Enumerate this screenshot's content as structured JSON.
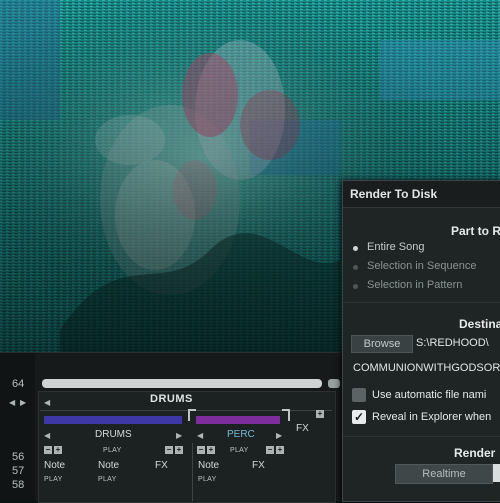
{
  "colors": {
    "accent_blue": "#3e37a6",
    "accent_purple": "#7d2e9c",
    "perc_text": "#77b9d6",
    "dialog_bg": "#1f2425",
    "background_art": "#1b8d8a"
  },
  "background": {
    "description_icon": "artwork-image"
  },
  "tracker": {
    "row_numbers": [
      "64",
      "56",
      "57",
      "58"
    ],
    "group_title": "DRUMS",
    "track1": {
      "name": "DRUMS",
      "play": "PLAY",
      "cols": [
        "Note",
        "Note",
        "FX"
      ],
      "sub": [
        "PLAY",
        "PLAY"
      ]
    },
    "track2": {
      "name": "PERC",
      "play": "PLAY",
      "cols": [
        "Note",
        "FX"
      ],
      "sub": [
        "PLAY"
      ]
    },
    "fx_label": "FX"
  },
  "dialog": {
    "title": "Render To Disk",
    "part_heading": "Part to R",
    "options": [
      "Entire Song",
      "Selection in Sequence",
      "Selection in Pattern"
    ],
    "destination_heading": "Destina",
    "browse_label": "Browse",
    "path_value": "S:\\REDHOOD\\",
    "filename_value": "COMMUNIONWITHGODSORA",
    "auto_naming_label": "Use automatic file nami",
    "reveal_label": "Reveal in Explorer when",
    "render_heading": "Render",
    "realtime_label": "Realtime"
  }
}
